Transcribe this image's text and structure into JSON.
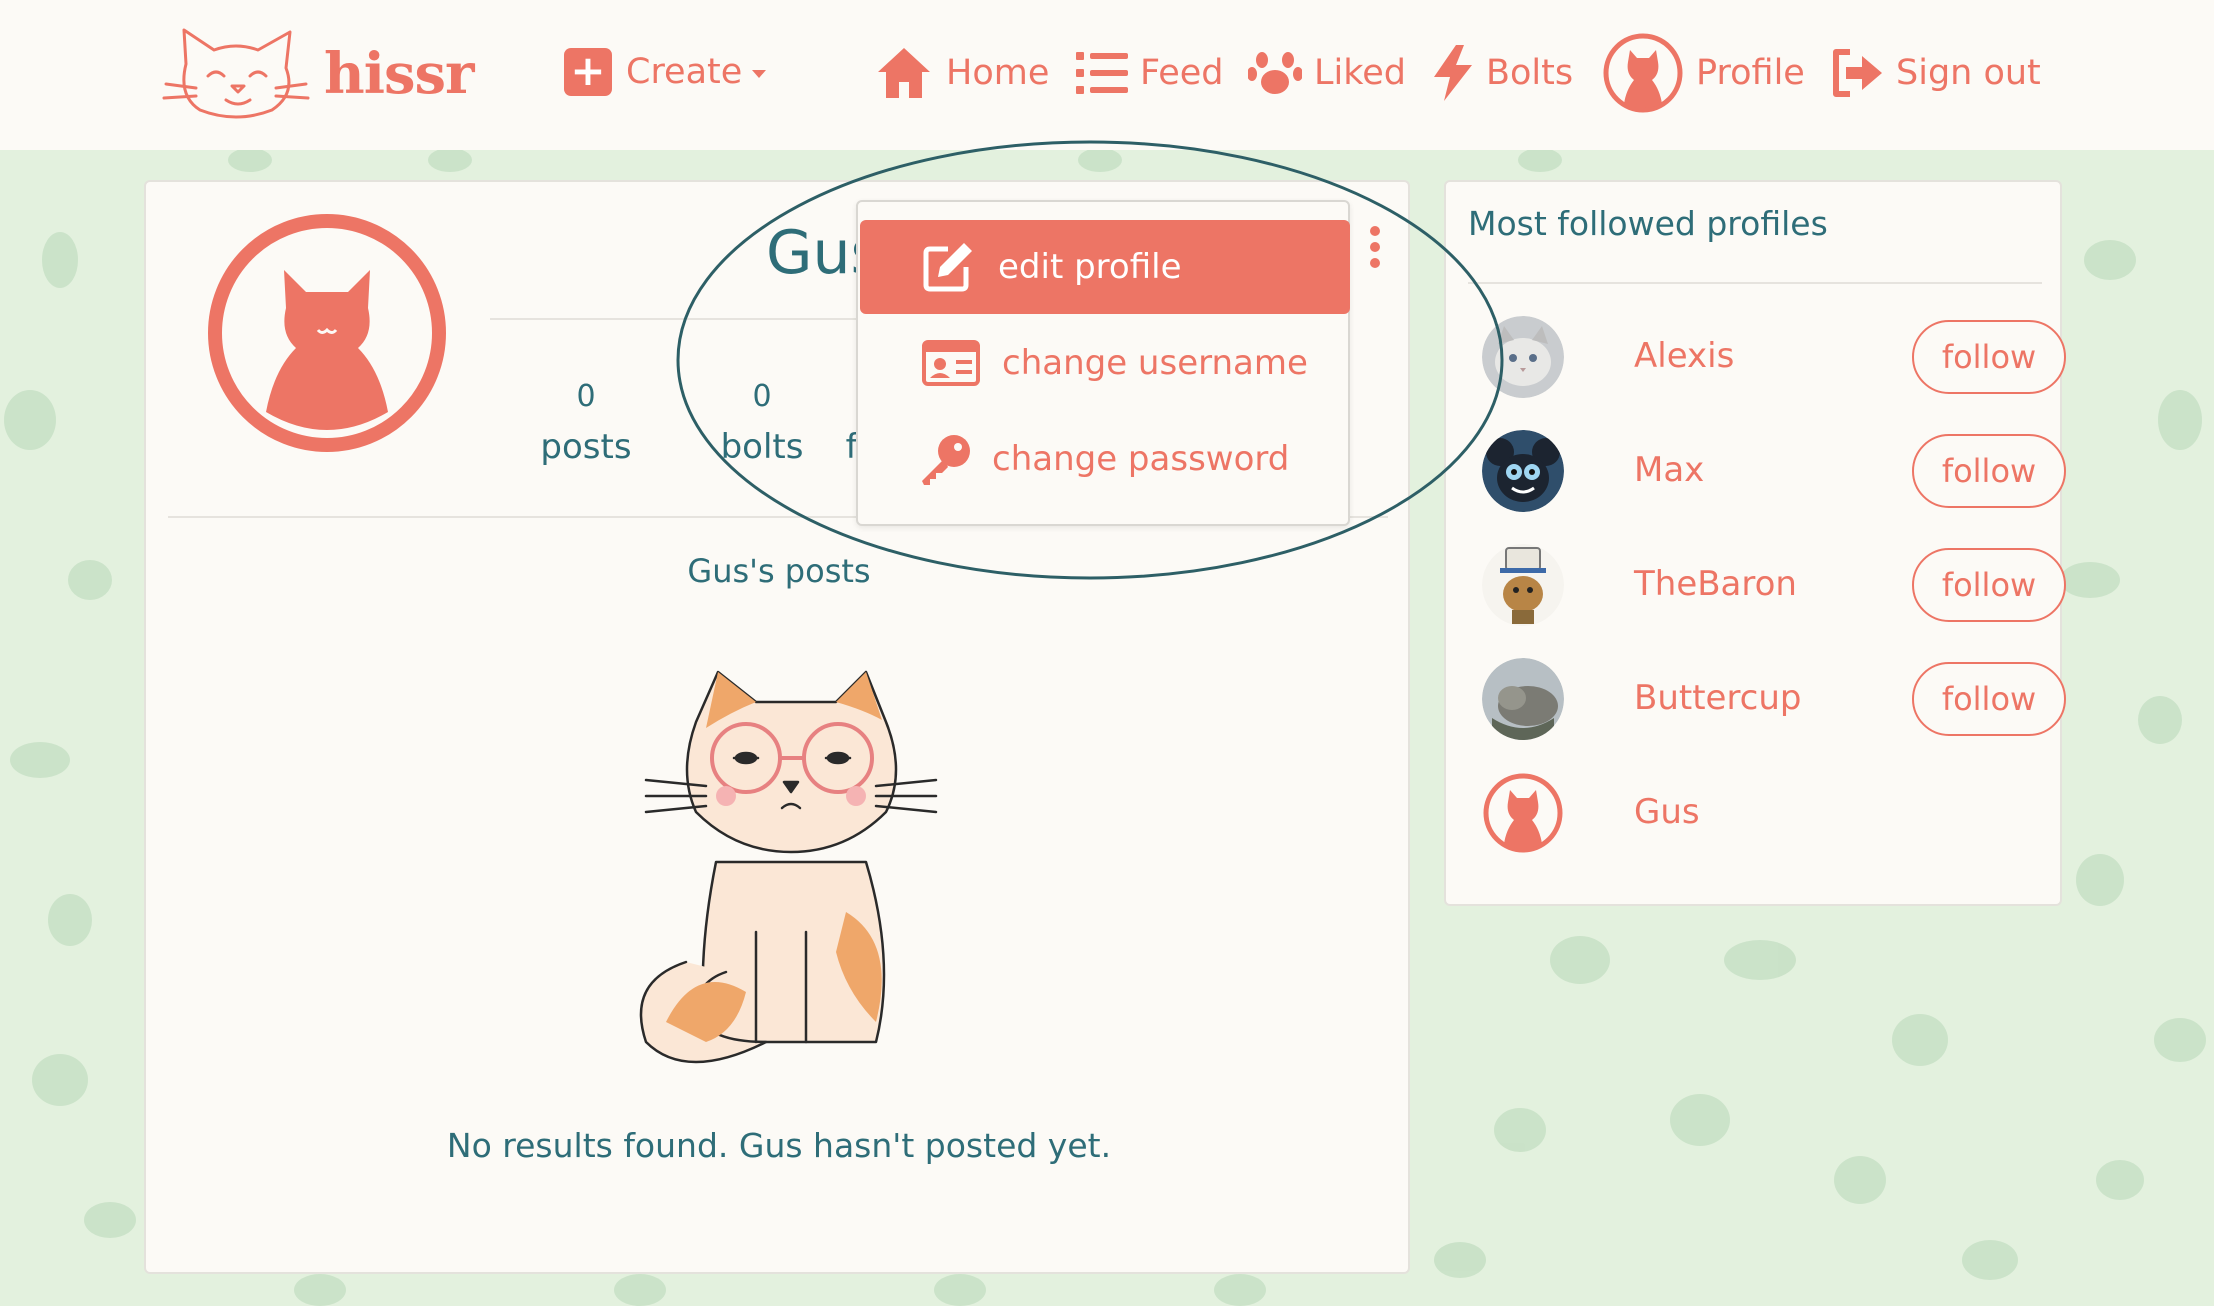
{
  "brand": {
    "name": "hissr",
    "color": "#ed7565"
  },
  "nav": {
    "create": "Create",
    "home": "Home",
    "feed": "Feed",
    "liked": "Liked",
    "bolts": "Bolts",
    "profile": "Profile",
    "sign_out": "Sign out"
  },
  "profile": {
    "username": "Gus",
    "stats": [
      {
        "num": "0",
        "label": "posts"
      },
      {
        "num": "0",
        "label": "bolts"
      },
      {
        "label": "fo"
      }
    ],
    "posts_heading": "Gus's posts",
    "empty_message": "No results found. Gus hasn't posted yet."
  },
  "menu": {
    "items": [
      {
        "label": "edit profile",
        "icon": "edit-icon",
        "active": true
      },
      {
        "label": "change username",
        "icon": "id-card-icon",
        "active": false
      },
      {
        "label": "change password",
        "icon": "key-icon",
        "active": false
      }
    ]
  },
  "sidebar": {
    "title": "Most followed profiles",
    "profiles": [
      {
        "name": "Alexis",
        "follow": "follow"
      },
      {
        "name": "Max",
        "follow": "follow"
      },
      {
        "name": "TheBaron",
        "follow": "follow"
      },
      {
        "name": "Buttercup",
        "follow": "follow"
      },
      {
        "name": "Gus"
      }
    ]
  },
  "colors": {
    "accent": "#ed7565",
    "text": "#2e6d78",
    "background": "#e3f1de",
    "card": "#fcfaf6",
    "annotation": "#2d5f66"
  }
}
